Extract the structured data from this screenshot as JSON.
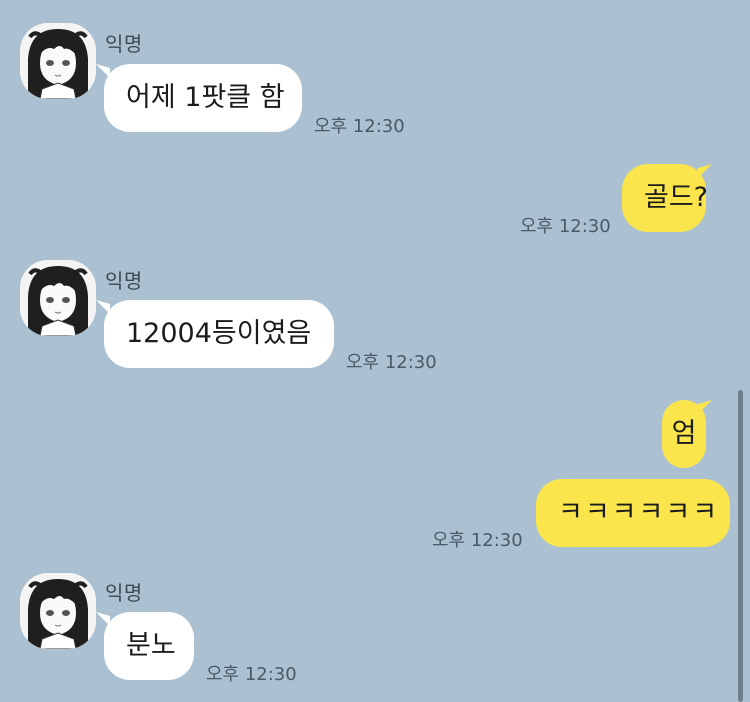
{
  "colors": {
    "background": "#abc1d1",
    "incoming_bubble": "#ffffff",
    "outgoing_bubble": "#fae64c"
  },
  "messages": [
    {
      "sender": "익명",
      "text": "어제 1팟클 함",
      "time": "오후 12:30",
      "direction": "in"
    },
    {
      "text": "골드?",
      "time": "오후 12:30",
      "direction": "out"
    },
    {
      "sender": "익명",
      "text": "12004등이였음",
      "time": "오후 12:30",
      "direction": "in"
    },
    {
      "text": "엄",
      "direction": "out"
    },
    {
      "text": "ㅋㅋㅋㅋㅋㅋ",
      "time": "오후 12:30",
      "direction": "out"
    },
    {
      "sender": "익명",
      "text": "분노",
      "time": "오후 12:30",
      "direction": "in"
    }
  ],
  "avatar_icon": "anime-girl-avatar-icon"
}
